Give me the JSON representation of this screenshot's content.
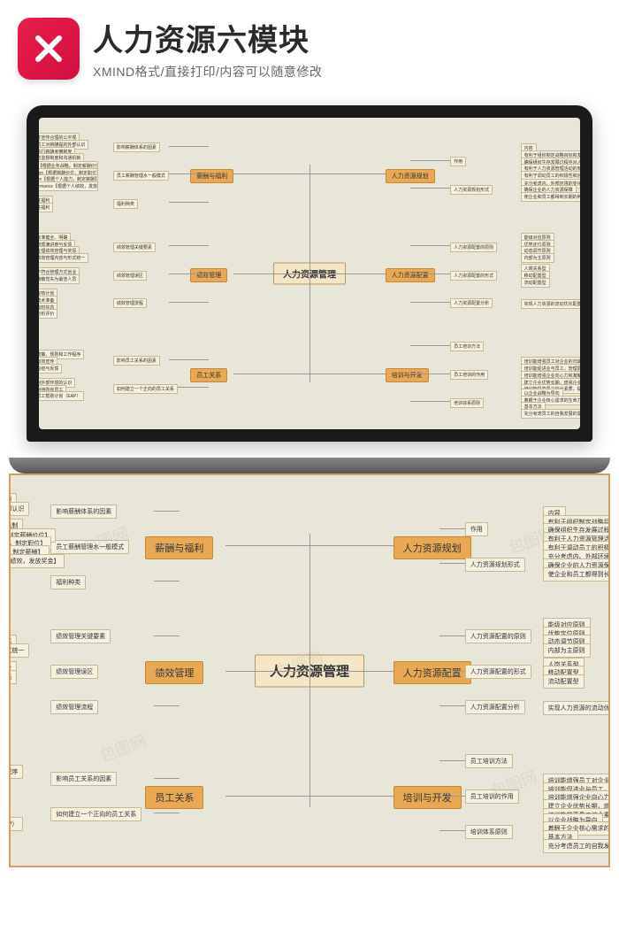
{
  "header": {
    "title": "人力资源六模块",
    "subtitle": "XMIND格式/直接打印/内容可以随意修改"
  },
  "mindmap": {
    "center": "人力资源管理",
    "branches": {
      "left": [
        {
          "name": "薪酬与福利",
          "groups": [
            {
              "label": "影响薪酬体系的因素",
              "items": [
                "建立并宣传合理的公平观",
                "增加员工对薪酬提的外部认识",
                "严格执行薪酬考察制度",
                "有效的监督制度和沟通机制"
              ]
            },
            {
              "label": "员工薪酬管理水一般模式",
              "items": [
                "Price【根据业务战略，制定薪酬价位】",
                "Position【根据薪酬价位，制定职位】",
                "Person【根据个人能力，制定薪酬】",
                "Performance【根据个人绩效，发放奖金】"
              ]
            },
            {
              "label": "福利种类",
              "items": [
                "经济性福利",
                "设施性福利"
              ]
            }
          ]
        },
        {
          "name": "绩效管理",
          "groups": [
            {
              "label": "绩效管理关键要素",
              "items": [
                "工作标准健全、明确",
                "绩效管理满进度与反馈",
                "正确处理绩效管理与奖惩",
                "注意绩效管理内容与形式统一"
              ]
            },
            {
              "label": "绩效管理误区",
              "items": [
                "鼓励不符合管理方式创业",
                "员工接触觉失为最佳人员"
              ]
            },
            {
              "label": "绩效管理流程",
              "items": [
                "制订考核计划",
                "进行技术准备",
                "收集资料信息",
                "做出分析评价"
              ]
            }
          ]
        },
        {
          "name": "员工关系",
          "groups": [
            {
              "label": "影响员工关系的因素",
              "items": [
                "制定政策、规则和工作程序",
                "进行有效宣传",
                "及时总结与反馈"
              ]
            },
            {
              "label": "如何建立一个正向的员工关系",
              "items": [
                "增强对外部环境的认识",
                "公平对待所有员工",
                "建立员工帮助计划（EAP）"
              ]
            }
          ]
        }
      ],
      "right": [
        {
          "name": "人力资源规划",
          "groups": [
            {
              "label": "作用",
              "items": [
                "内容",
                "有利于组织制定战略目标和发展规划",
                "确保组织生存发展过程中对人力资源的需求",
                "有利于人力资源管理活动的有序化",
                "有利于调动员工的积极性和创造性"
              ]
            },
            {
              "label": "人力资源规划形式",
              "items": [
                "充分考虑内、外部环境的变化",
                "确保企业的人力资源保障",
                "使企业和员工都得到长期的利益"
              ]
            }
          ]
        },
        {
          "name": "人力资源配置",
          "groups": [
            {
              "label": "人力资源配置的原则",
              "items": [
                "能级对应原则",
                "优势定位原则",
                "动态调节原则",
                "内部为主原则"
              ]
            },
            {
              "label": "人力资源配置的形式",
              "items": [
                "人岗关系型",
                "移动配置型",
                "流动配置型"
              ]
            },
            {
              "label": "人力资源配置分析",
              "items": [
                "实现人力资源的流动优化配置"
              ]
            }
          ]
        },
        {
          "name": "培训与开发",
          "groups": [
            {
              "label": "员工培训方法",
              "items": []
            },
            {
              "label": "员工培训的作用",
              "items": [
                "培训能增强员工对企业的归属感和主人翁责任感",
                "培训能促进业与员工，管理层与员工层的双向沟通",
                "培训能增强企业向心力和凝聚力，塑造优秀的企业文化",
                "建立企业优势长期，增强企业自身竞争能力",
                "培训能提高员工综合素质，提高生产效率"
              ]
            },
            {
              "label": "培训体系原则",
              "items": [
                "以企业战略为导向",
                "着眼于企业核心需求的生命力",
                "基本方法",
                "充分考虑员工的自我发展的需要"
              ]
            }
          ]
        }
      ]
    }
  },
  "watermark": "包图网"
}
